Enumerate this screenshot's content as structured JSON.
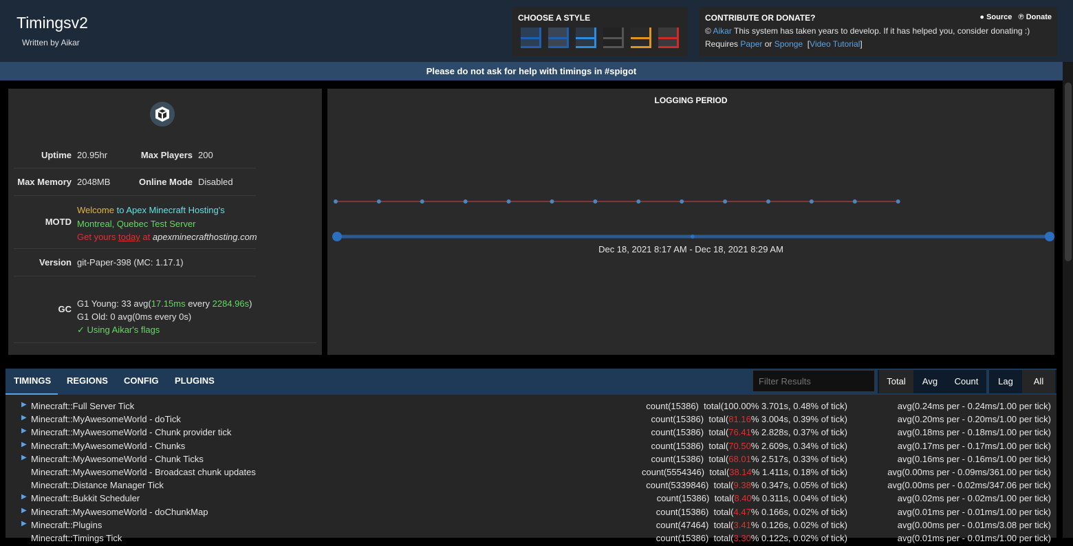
{
  "header": {
    "title": "Timingsv2",
    "subtitle": "Written by Aikar",
    "style_heading": "CHOOSE A STYLE",
    "style_swatches": [
      {
        "name": "blue-dark",
        "base": "#2b3f57",
        "accent": "#1f5fb0"
      },
      {
        "name": "blue-gray",
        "base": "#3a4656",
        "accent": "#1f5fb0"
      },
      {
        "name": "blue-bright",
        "base": "#2c3846",
        "accent": "#2e8ce0"
      },
      {
        "name": "black",
        "base": "#222222",
        "accent": "#555555"
      },
      {
        "name": "orange",
        "base": "#2a2a2a",
        "accent": "#e0951e"
      },
      {
        "name": "red",
        "base": "#3a3a3a",
        "accent": "#cf2a2a"
      }
    ],
    "donate": {
      "heading": "CONTRIBUTE OR DONATE?",
      "source_label": "Source",
      "donate_label": "Donate",
      "copyright": "©",
      "author_link": "Aikar",
      "message": "This system has taken years to develop. If it has helped you, consider donating :)",
      "requires": "Requires",
      "paper": "Paper",
      "or": "or",
      "sponge": "Sponge",
      "video": "Video Tutorial"
    },
    "notice": "Please do not ask for help with timings in #spigot"
  },
  "server": {
    "uptime_label": "Uptime",
    "uptime": "20.95hr",
    "max_players_label": "Max Players",
    "max_players": "200",
    "max_memory_label": "Max Memory",
    "max_memory": "2048MB",
    "online_mode_label": "Online Mode",
    "online_mode": "Disabled",
    "motd_label": "MOTD",
    "motd": {
      "l1a": "Welcome",
      "l1b": "to Apex Minecraft Hosting's",
      "l2a": "Montreal,",
      "l2b": "Quebec",
      "l2c": "Test Server",
      "l3a": "Get yours",
      "l3b": "today",
      "l3c": "at",
      "l3d": "apexminecrafthosting.com"
    },
    "version_label": "Version",
    "version": "git-Paper-398 (MC: 1.17.1)",
    "gc_label": "GC",
    "gc": {
      "young_a": "G1 Young: 33 avg(",
      "young_b": "17.15ms",
      "young_c": "every",
      "young_d": "2284.96s",
      "young_e": ")",
      "old": "G1 Old: 0 avg(0ms every 0s)",
      "flags": "✓ Using Aikar's flags"
    }
  },
  "graph": {
    "title": "LOGGING PERIOD",
    "range": "Dec 18, 2021 8:17 AM - Dec 18, 2021 8:29 AM",
    "points": 14
  },
  "tabs": [
    "TIMINGS",
    "REGIONS",
    "CONFIG",
    "PLUGINS"
  ],
  "filter_placeholder": "Filter Results",
  "sort_buttons": [
    "Total",
    "Avg",
    "Count"
  ],
  "mode_buttons": [
    "Lag",
    "All"
  ],
  "timings": [
    {
      "expand": true,
      "name": "Minecraft::Full Server Tick",
      "count": "count(15386)",
      "total_pre": "total(",
      "pct": "100.00",
      "pct_red": false,
      "total_post": "% 3.701s, 0.48% of tick)",
      "avg": "avg(0.24ms per - 0.24ms/1.00 per tick)"
    },
    {
      "expand": true,
      "name": "Minecraft::MyAwesomeWorld - doTick",
      "count": "count(15386)",
      "total_pre": "total(",
      "pct": "81.16",
      "pct_red": true,
      "total_post": "% 3.004s, 0.39% of tick)",
      "avg": "avg(0.20ms per - 0.20ms/1.00 per tick)"
    },
    {
      "expand": true,
      "name": "Minecraft::MyAwesomeWorld - Chunk provider tick",
      "count": "count(15386)",
      "total_pre": "total(",
      "pct": "76.41",
      "pct_red": true,
      "total_post": "% 2.828s, 0.37% of tick)",
      "avg": "avg(0.18ms per - 0.18ms/1.00 per tick)"
    },
    {
      "expand": true,
      "name": "Minecraft::MyAwesomeWorld - Chunks",
      "count": "count(15386)",
      "total_pre": "total(",
      "pct": "70.50",
      "pct_red": true,
      "total_post": "% 2.609s, 0.34% of tick)",
      "avg": "avg(0.17ms per - 0.17ms/1.00 per tick)"
    },
    {
      "expand": true,
      "name": "Minecraft::MyAwesomeWorld - Chunk Ticks",
      "count": "count(15386)",
      "total_pre": "total(",
      "pct": "68.01",
      "pct_red": true,
      "total_post": "% 2.517s, 0.33% of tick)",
      "avg": "avg(0.16ms per - 0.16ms/1.00 per tick)"
    },
    {
      "expand": false,
      "name": "Minecraft::MyAwesomeWorld - Broadcast chunk updates",
      "count": "count(5554346)",
      "total_pre": "total(",
      "pct": "38.14",
      "pct_red": true,
      "total_post": "% 1.411s, 0.18% of tick)",
      "avg": "avg(0.00ms per - 0.09ms/361.00 per tick)"
    },
    {
      "expand": false,
      "name": "Minecraft::Distance Manager Tick",
      "count": "count(5339846)",
      "total_pre": "total(",
      "pct": "9.38",
      "pct_red": true,
      "total_post": "% 0.347s, 0.05% of tick)",
      "avg": "avg(0.00ms per - 0.02ms/347.06 per tick)"
    },
    {
      "expand": true,
      "name": "Minecraft::Bukkit Scheduler",
      "count": "count(15386)",
      "total_pre": "total(",
      "pct": "8.40",
      "pct_red": true,
      "total_post": "% 0.311s, 0.04% of tick)",
      "avg": "avg(0.02ms per - 0.02ms/1.00 per tick)"
    },
    {
      "expand": true,
      "name": "Minecraft::MyAwesomeWorld - doChunkMap",
      "count": "count(15386)",
      "total_pre": "total(",
      "pct": "4.47",
      "pct_red": true,
      "total_post": "% 0.166s, 0.02% of tick)",
      "avg": "avg(0.01ms per - 0.01ms/1.00 per tick)"
    },
    {
      "expand": true,
      "name": "Minecraft::Plugins",
      "count": "count(47464)",
      "total_pre": "total(",
      "pct": "3.41",
      "pct_red": true,
      "total_post": "% 0.126s, 0.02% of tick)",
      "avg": "avg(0.00ms per - 0.01ms/3.08 per tick)"
    },
    {
      "expand": false,
      "name": "Minecraft::Timings Tick",
      "count": "count(15386)",
      "total_pre": "total(",
      "pct": "3.30",
      "pct_red": true,
      "total_post": "% 0.122s, 0.02% of tick)",
      "avg": "avg(0.01ms per - 0.01ms/1.00 per tick)"
    }
  ]
}
